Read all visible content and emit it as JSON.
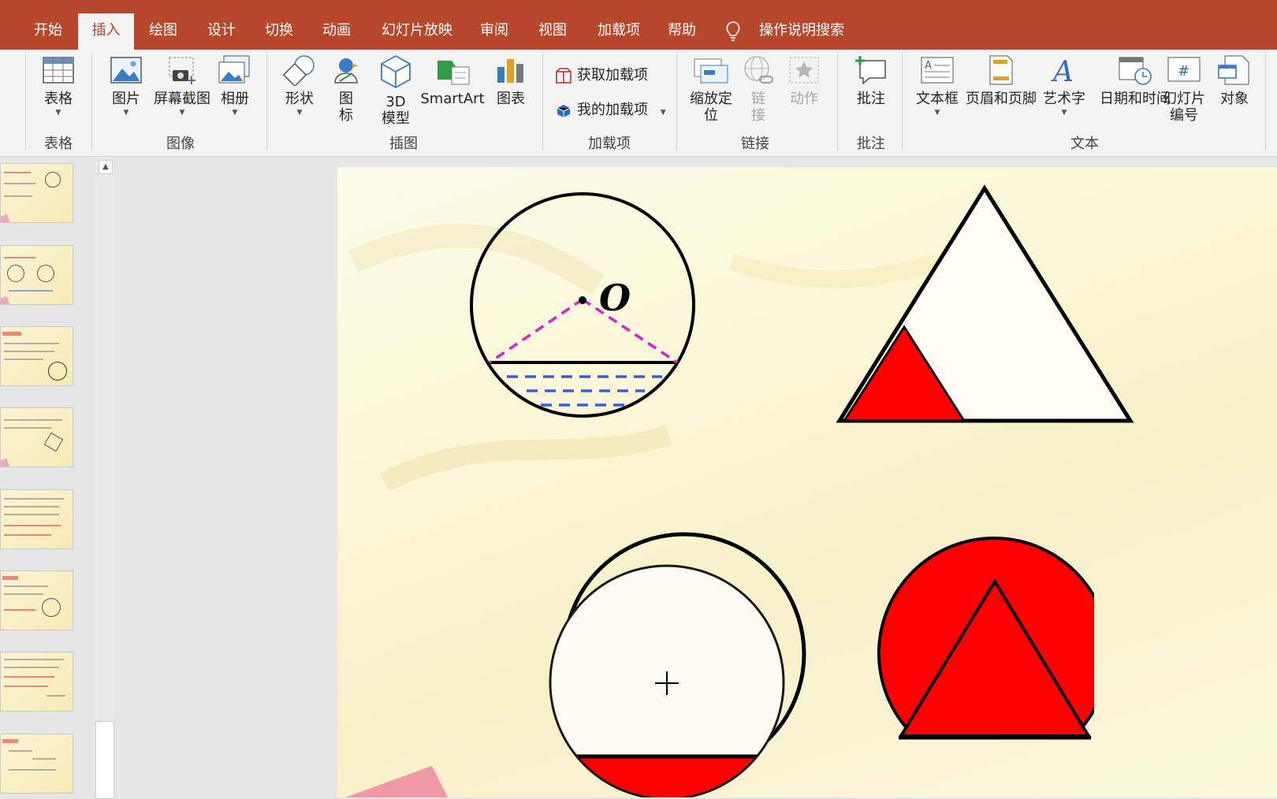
{
  "tabs": [
    {
      "label": "开始",
      "active": false
    },
    {
      "label": "插入",
      "active": true
    },
    {
      "label": "绘图",
      "active": false
    },
    {
      "label": "设计",
      "active": false
    },
    {
      "label": "切换",
      "active": false
    },
    {
      "label": "动画",
      "active": false
    },
    {
      "label": "幻灯片放映",
      "active": false
    },
    {
      "label": "审阅",
      "active": false
    },
    {
      "label": "视图",
      "active": false
    },
    {
      "label": "加载项",
      "active": false
    },
    {
      "label": "帮助",
      "active": false
    }
  ],
  "tell_me": {
    "label": "操作说明搜索",
    "icon": "lightbulb-icon"
  },
  "ribbon": {
    "buttons": {
      "table": {
        "label": "表格",
        "icon": "table-icon"
      },
      "pictures": {
        "label": "图片",
        "icon": "picture-icon"
      },
      "screenshot": {
        "label": "屏幕截图",
        "icon": "screenshot-icon"
      },
      "album": {
        "label": "相册",
        "icon": "photo-album-icon"
      },
      "shapes": {
        "label": "形状",
        "icon": "shapes-icon"
      },
      "icons": {
        "label": "图\n标",
        "icon": "icons-icon"
      },
      "model3d": {
        "label": "3D\n模型",
        "icon": "3d-model-icon"
      },
      "smartart": {
        "label": "SmartArt",
        "icon": "smartart-icon"
      },
      "chart": {
        "label": "图表",
        "icon": "chart-icon"
      },
      "get_addins": {
        "label": "获取加载项",
        "icon": "store-icon"
      },
      "my_addins": {
        "label": "我的加载项",
        "icon": "my-addins-icon"
      },
      "zoom": {
        "label": "缩放定\n位",
        "icon": "zoom-icon"
      },
      "link": {
        "label": "链\n接",
        "icon": "link-icon",
        "disabled": true
      },
      "action": {
        "label": "动作",
        "icon": "action-icon",
        "disabled": true
      },
      "comment": {
        "label": "批注",
        "icon": "comment-icon"
      },
      "textbox": {
        "label": "文本框",
        "icon": "textbox-icon"
      },
      "header_footer": {
        "label": "页眉和页脚",
        "icon": "header-footer-icon"
      },
      "wordart": {
        "label": "艺术字",
        "icon": "wordart-icon"
      },
      "datetime": {
        "label": "日期和时间",
        "icon": "datetime-icon"
      },
      "slide_number": {
        "label": "幻灯片\n编号",
        "icon": "slide-number-icon"
      },
      "object": {
        "label": "对象",
        "icon": "object-icon"
      }
    },
    "groups": {
      "table": "表格",
      "images": "图像",
      "illustrations": "插图",
      "addins": "加载项",
      "links": "链接",
      "comments": "批注",
      "text": "文本"
    }
  },
  "slide": {
    "center_label": "O"
  },
  "colors": {
    "brand": "#b7472a",
    "shape_red": "#ff0000",
    "dash_magenta": "#e020d0",
    "dash_blue": "#3a5be0"
  }
}
